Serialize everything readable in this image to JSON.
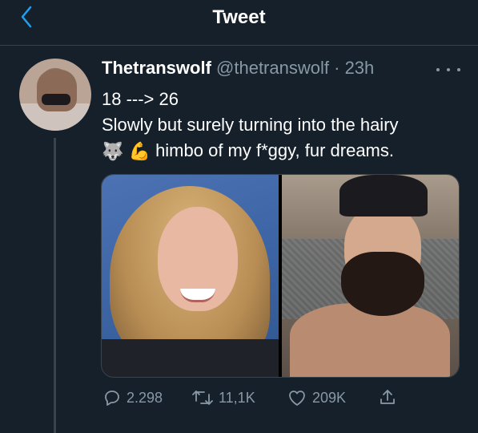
{
  "header": {
    "title": "Tweet"
  },
  "tweet": {
    "display_name": "Thetranswolf",
    "handle": "@thetranswolf",
    "separator": "·",
    "time": "23h",
    "line1": "18 ---> 26",
    "line2": "Slowly but surely turning into the hairy",
    "emoji_wolf": "🐺",
    "emoji_muscle": "💪",
    "line3": "himbo of my f*ggy, fur dreams.",
    "stats": {
      "replies": "2.298",
      "retweets": "11,1K",
      "likes": "209K"
    }
  },
  "icons": [
    "back-chevron-icon",
    "more-icon",
    "reply-icon",
    "retweet-icon",
    "like-icon",
    "share-icon"
  ],
  "colors": {
    "background": "#15202b",
    "accent": "#1da1f2",
    "muted": "#8899a6",
    "divider": "#38444d"
  }
}
